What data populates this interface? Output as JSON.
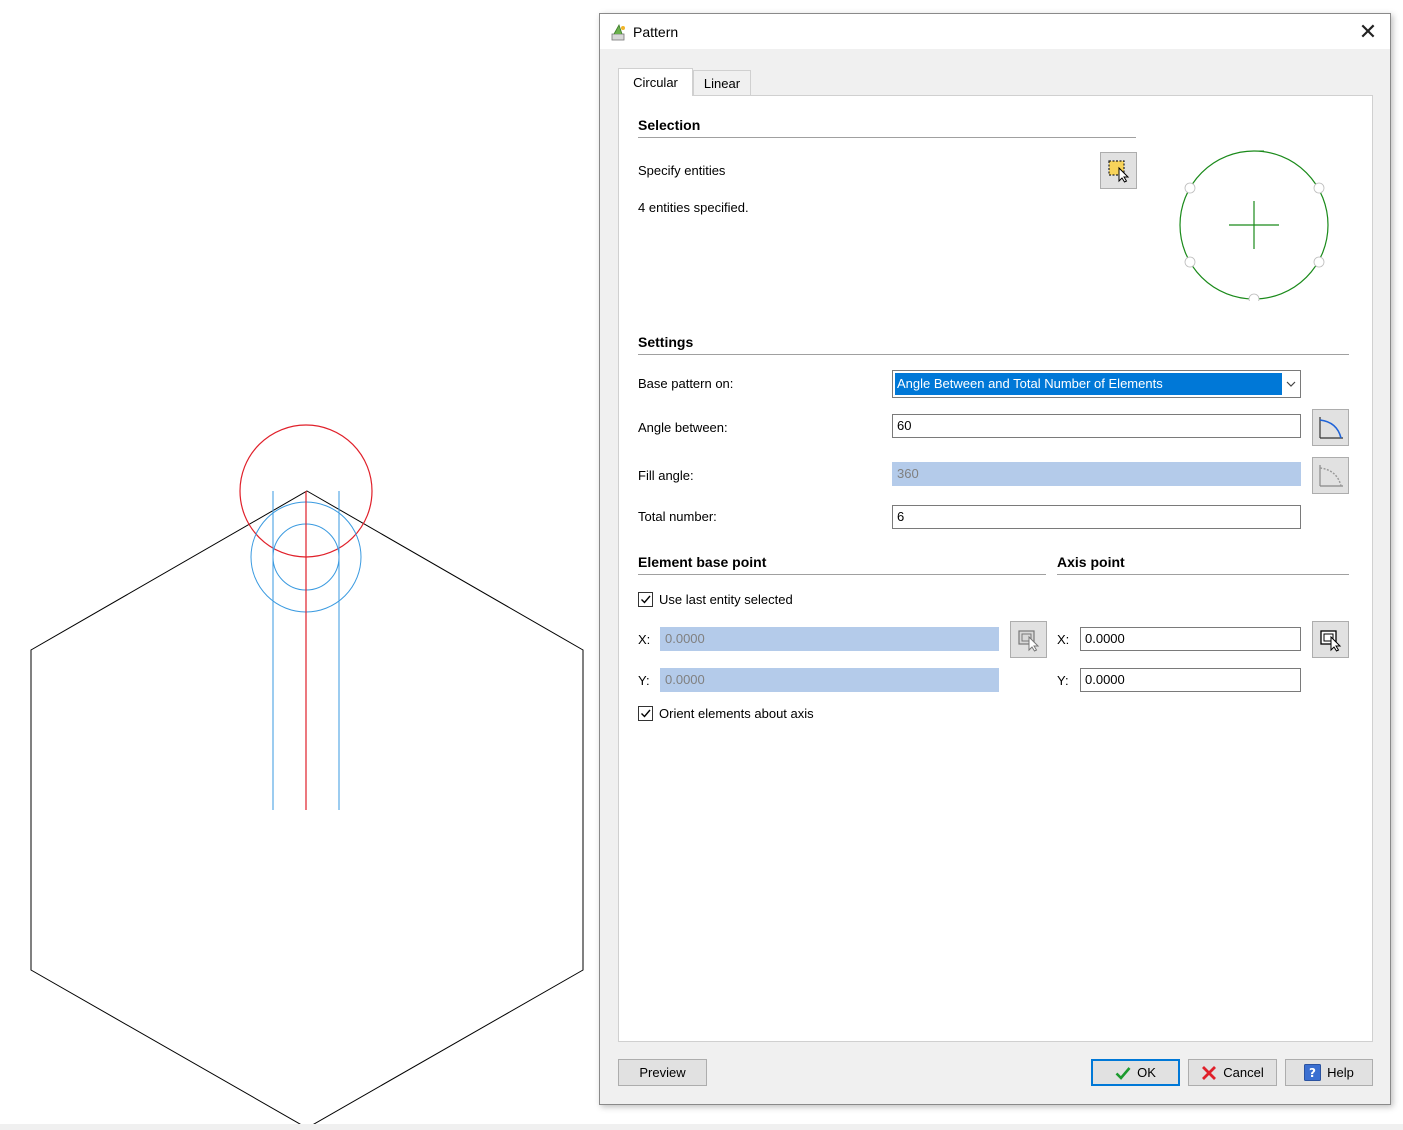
{
  "dialog": {
    "title": "Pattern",
    "close_glyph": "✕",
    "icon": "pattern-app-icon"
  },
  "tabs": [
    {
      "label": "Circular",
      "active": true
    },
    {
      "label": "Linear",
      "active": false
    }
  ],
  "selection": {
    "section_title": "Selection",
    "specify_label": "Specify entities",
    "status": "4 entities specified.",
    "select_icon": "select-entities-icon"
  },
  "settings": {
    "section_title": "Settings",
    "base_pattern_label": "Base pattern on:",
    "base_pattern_value": "Angle Between and Total Number of Elements",
    "angle_between_label": "Angle between:",
    "angle_between_value": "60",
    "fill_angle_label": "Fill angle:",
    "fill_angle_value": "360",
    "total_number_label": "Total number:",
    "total_number_value": "6"
  },
  "element_base_point": {
    "section_title": "Element base point",
    "use_last_label": "Use last entity selected",
    "use_last_checked": true,
    "x_label": "X:",
    "x_value": "0.0000",
    "y_label": "Y:",
    "y_value": "0.0000"
  },
  "axis_point": {
    "section_title": "Axis point",
    "x_label": "X:",
    "x_value": "0.0000",
    "y_label": "Y:",
    "y_value": "0.0000"
  },
  "orient": {
    "label": "Orient elements about axis",
    "checked": true
  },
  "buttons": {
    "preview": "Preview",
    "ok": "OK",
    "cancel": "Cancel",
    "help": "Help"
  },
  "colors": {
    "selection_highlight": "#0078d7",
    "disabled_field": "#b4cbea",
    "preview_circle": "#1a8a1a",
    "sketch_red": "#e0202a",
    "sketch_blue": "#3a9ae0",
    "sketch_black": "#000000"
  }
}
